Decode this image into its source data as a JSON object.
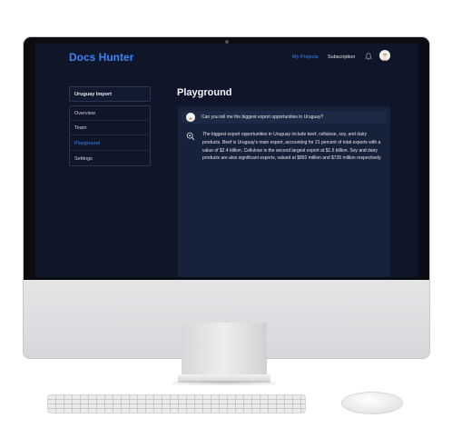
{
  "app": {
    "brand": "Docs Hunter",
    "nav": {
      "my_projects": "My Projects",
      "subscription": "Subscription"
    }
  },
  "sidebar": {
    "title": "Uruguay Import",
    "items": [
      {
        "label": "Overview",
        "active": false
      },
      {
        "label": "Team",
        "active": false
      },
      {
        "label": "Playground",
        "active": true
      },
      {
        "label": "Settings",
        "active": false
      }
    ]
  },
  "main": {
    "title": "Playground",
    "conversation": {
      "question": "Can you tell me the biggest export opportunities in Uruguay?",
      "answer": "The biggest export opportunities in Uruguay include beef, cellulose, soy, and dairy products. Beef is Uruguay's main export, accounting for 21 percent of total exports with a value of $2.4 billion. Cellulose is the second largest export at $1.5 billion. Soy and dairy products are also significant exports, valued at $892 million and $735 million respectively."
    }
  },
  "icons": {
    "bell": "bell-icon",
    "avatar": "user-avatar",
    "assistant": "magnifier-bot-icon"
  },
  "colors": {
    "screen_bg": "#0f1629",
    "accent": "#3b82f6",
    "panel_bg": "#16223a"
  }
}
